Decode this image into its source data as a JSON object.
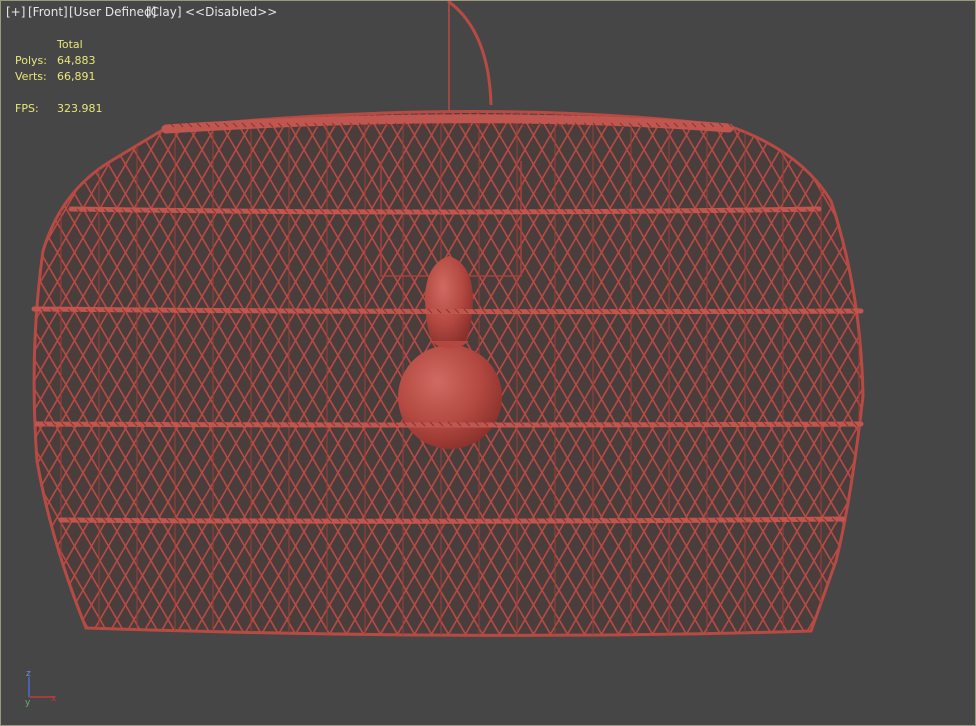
{
  "viewport": {
    "menu_plus": "[+]",
    "view": "[Front]",
    "shading_mode": "[User Defined]",
    "material": "[Clay]",
    "status": "<<Disabled>>"
  },
  "stats": {
    "header": "Total",
    "polys_label": "Polys:",
    "polys_value": "64,883",
    "verts_label": "Verts:",
    "verts_value": "66,891",
    "fps_label": "FPS:",
    "fps_value": "323.981"
  },
  "axis_gizmo": {
    "z": "z",
    "y": "y",
    "x": "x"
  },
  "colors": {
    "background": "#464646",
    "model": "#b84a44",
    "stats_text": "#e8e67a",
    "label_text": "#e6e6e6"
  }
}
